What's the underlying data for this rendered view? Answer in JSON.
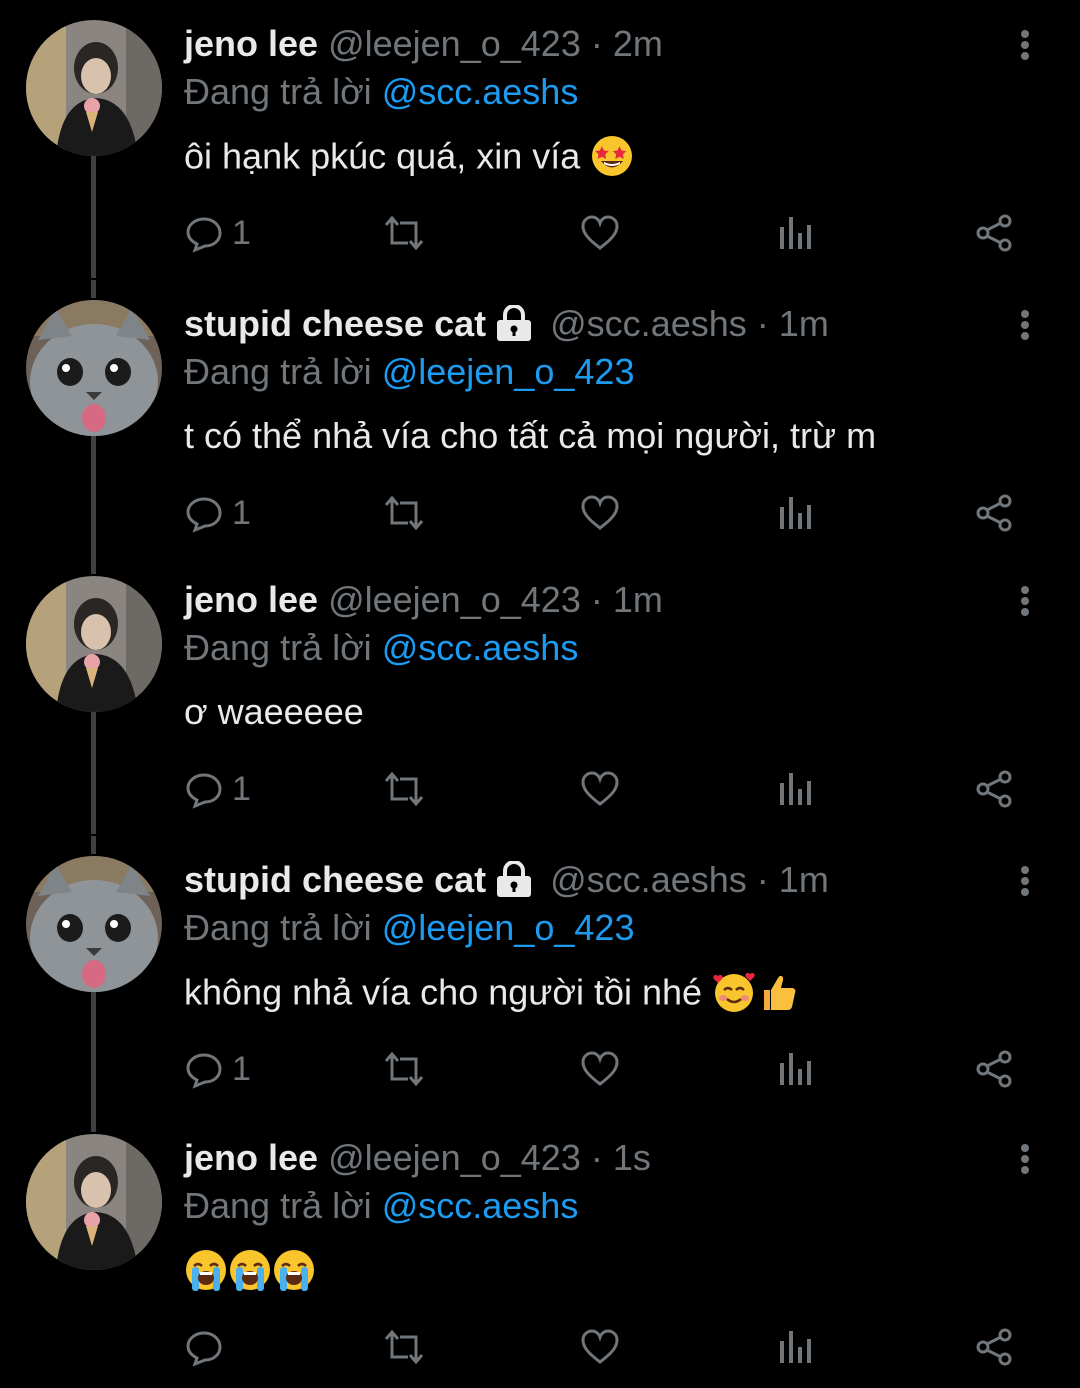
{
  "tweets": [
    {
      "name": "jeno lee",
      "handle": "@leejen_o_423",
      "sep": "·",
      "time": "2m",
      "replying_prefix": "Đang trả lời",
      "replying_to": "@scc.aeshs",
      "text": "ôi hạnk pkúc quá, xin vía",
      "emojis": [
        "star-struck"
      ],
      "reply_count": "1",
      "locked": false,
      "avatar": "person-avatar"
    },
    {
      "name": "stupid cheese cat",
      "handle": "@scc.aeshs",
      "sep": "·",
      "time": "1m",
      "replying_prefix": "Đang trả lời",
      "replying_to": "@leejen_o_423",
      "text": "t có thể nhả vía cho tất cả mọi người, trừ m",
      "emojis": [],
      "reply_count": "1",
      "locked": true,
      "avatar": "cat-avatar"
    },
    {
      "name": "jeno lee",
      "handle": "@leejen_o_423",
      "sep": "·",
      "time": "1m",
      "replying_prefix": "Đang trả lời",
      "replying_to": "@scc.aeshs",
      "text": "ơ waeeeee",
      "emojis": [],
      "reply_count": "1",
      "locked": false,
      "avatar": "person-avatar"
    },
    {
      "name": "stupid cheese cat",
      "handle": "@scc.aeshs",
      "sep": "·",
      "time": "1m",
      "replying_prefix": "Đang trả lời",
      "replying_to": "@leejen_o_423",
      "text": "không nhả vía cho người tồi nhé",
      "emojis": [
        "smiling-hearts",
        "thumbs-up"
      ],
      "reply_count": "1",
      "locked": true,
      "avatar": "cat-avatar"
    },
    {
      "name": "jeno lee",
      "handle": "@leejen_o_423",
      "sep": "·",
      "time": "1s",
      "replying_prefix": "Đang trả lời",
      "replying_to": "@scc.aeshs",
      "text": "",
      "emojis": [
        "crying",
        "crying",
        "crying"
      ],
      "reply_count": "",
      "locked": false,
      "avatar": "person-avatar"
    }
  ],
  "colors": {
    "background": "#000000",
    "text": "#e7e9ea",
    "muted": "#71767b",
    "link": "#1d9bf0",
    "thread": "#3e4144"
  }
}
